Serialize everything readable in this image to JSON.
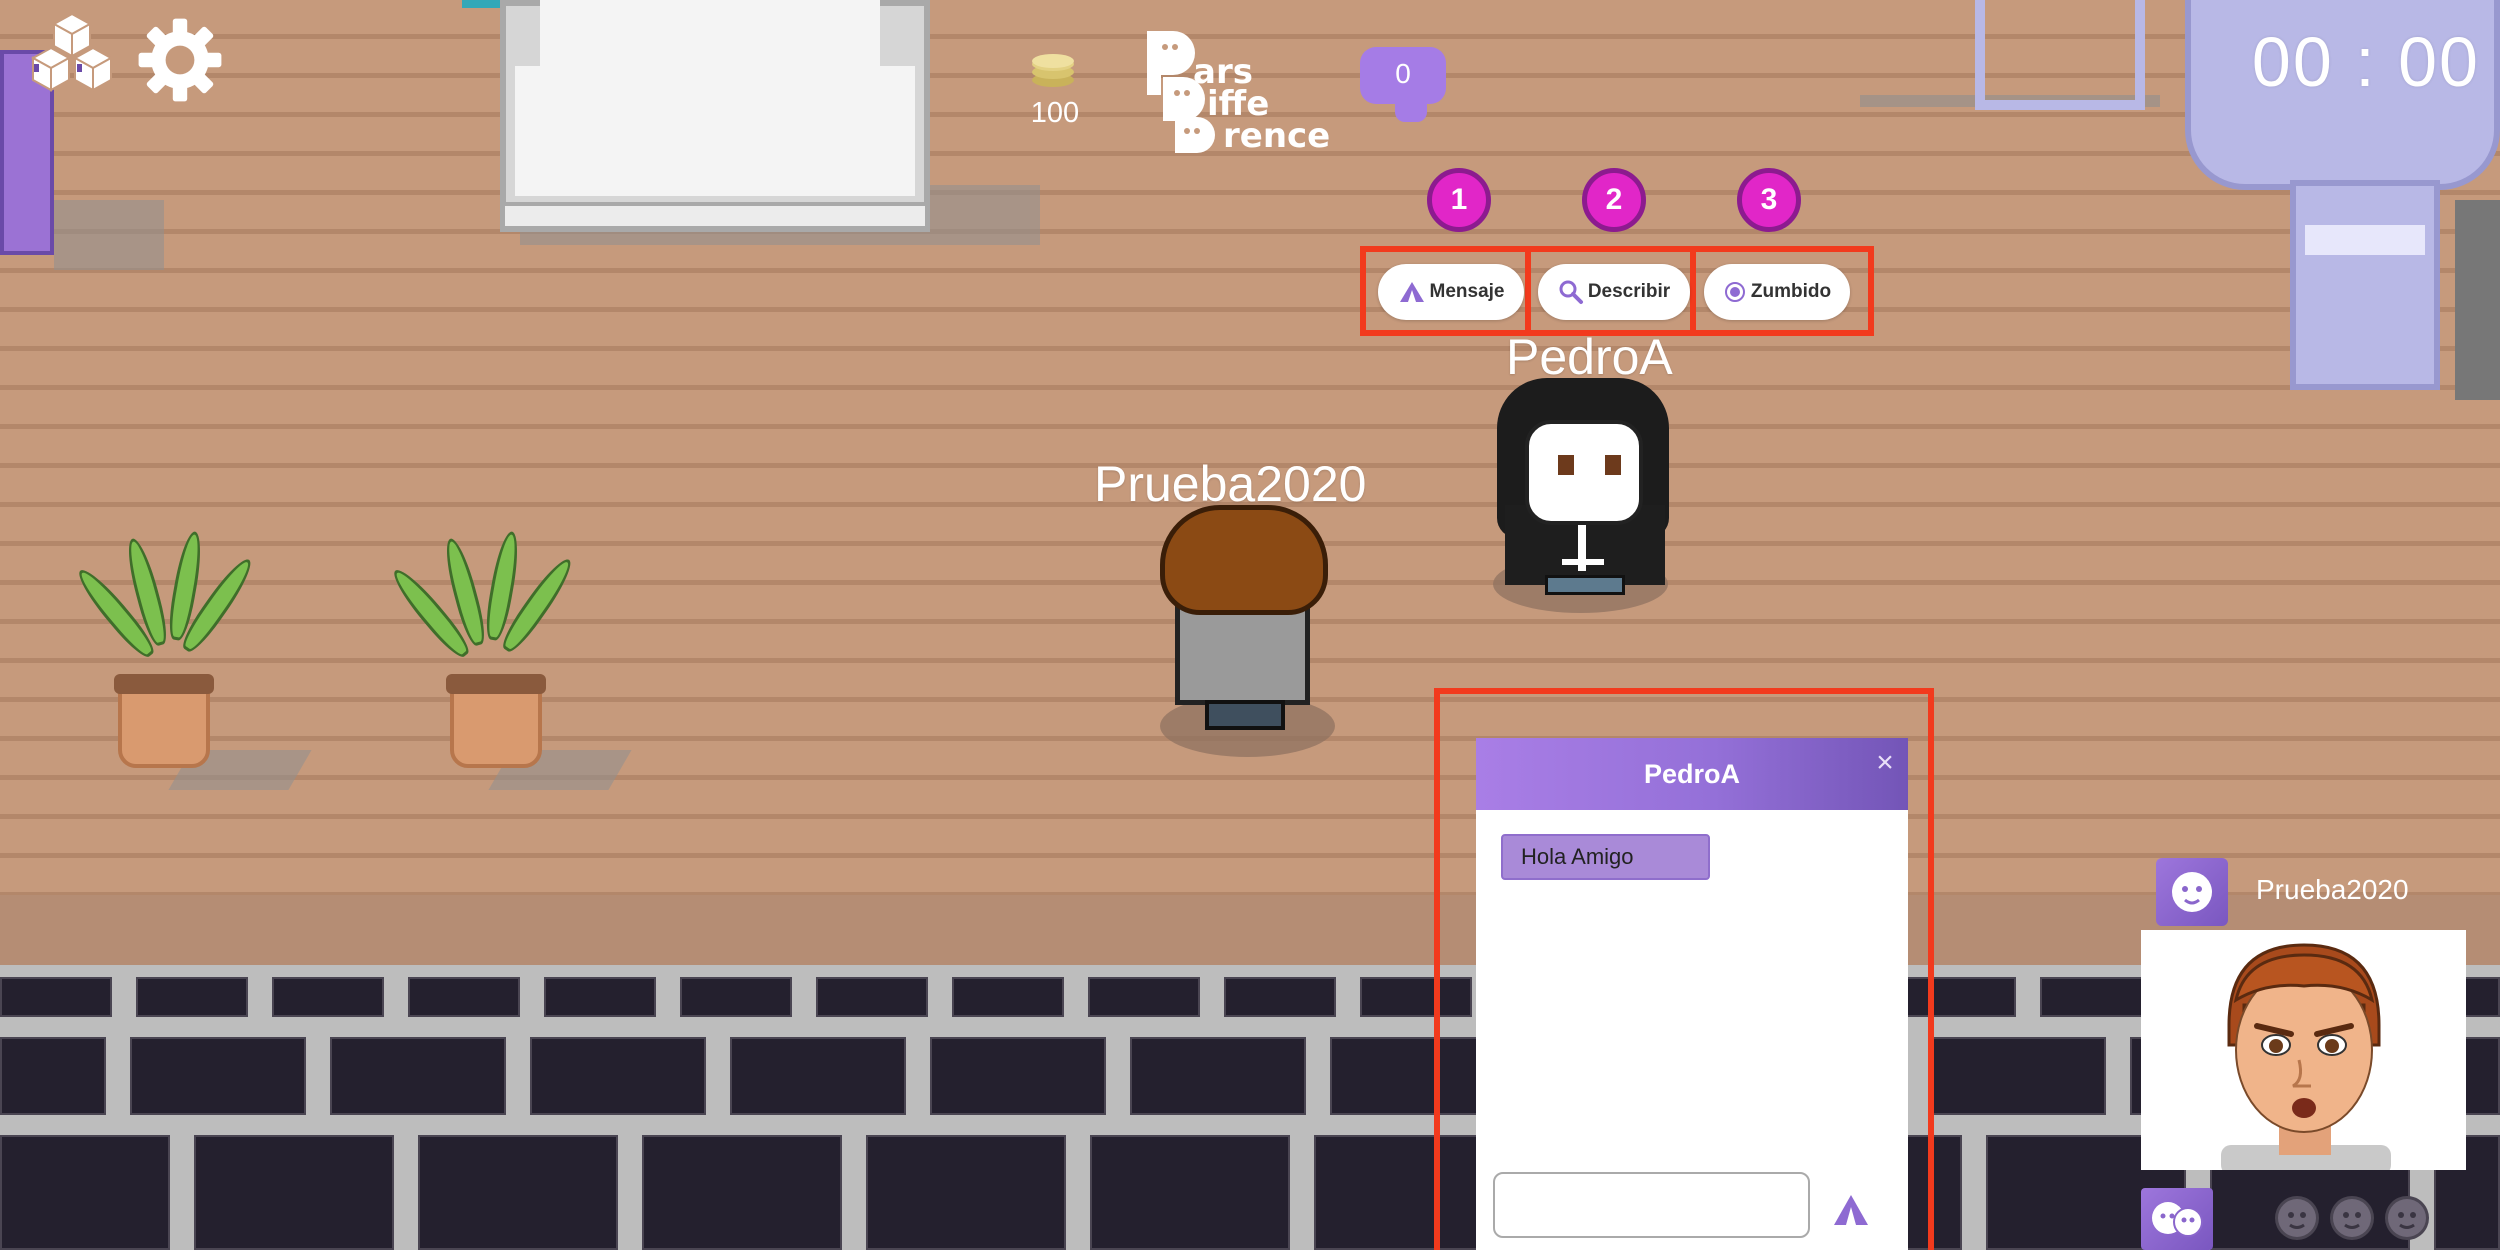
{
  "hud": {
    "coins": "100",
    "logo_lines": [
      "ars",
      "iffe",
      "rence"
    ],
    "message_count": "0",
    "timer": "00 : 00"
  },
  "actions": [
    {
      "number": "1",
      "label": "Mensaje",
      "icon": "send-triangle-icon"
    },
    {
      "number": "2",
      "label": "Describir",
      "icon": "magnifier-icon"
    },
    {
      "number": "3",
      "label": "Zumbido",
      "icon": "buzz-circle-icon"
    }
  ],
  "characters": {
    "self_name": "Prueba2020",
    "other_name": "PedroA"
  },
  "chat": {
    "title": "PedroA",
    "close_label": "×",
    "messages": [
      "Hola Amigo"
    ],
    "input_value": ""
  },
  "player_panel": {
    "name": "Prueba2020"
  },
  "colors": {
    "floor": "#c69a7c",
    "accent_purple": "#a57ce6",
    "badge_magenta": "#e126c8",
    "highlight_red": "#f23a1d"
  }
}
